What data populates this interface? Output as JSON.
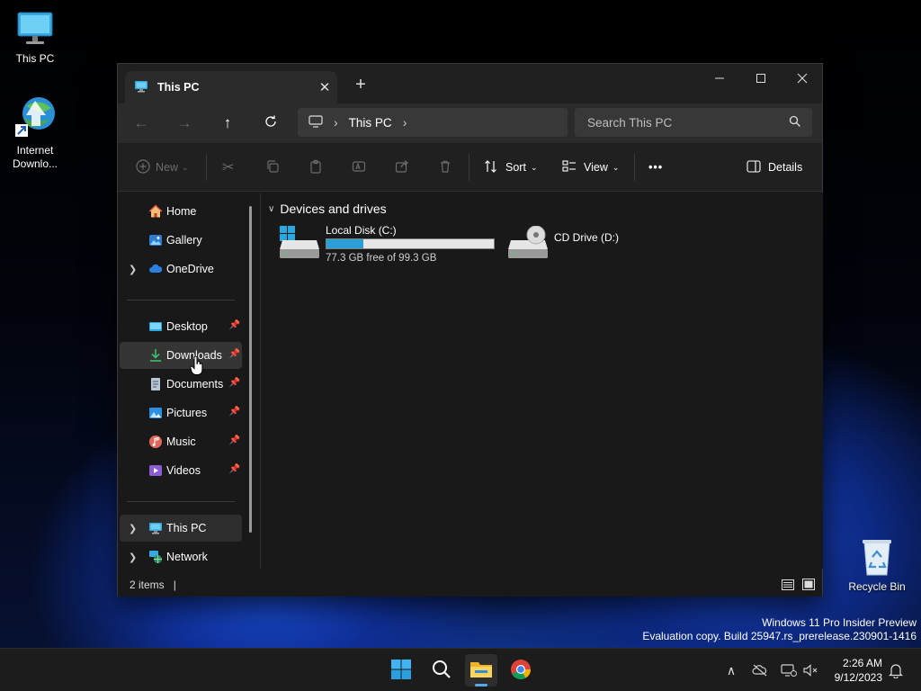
{
  "desktop": {
    "icons": [
      {
        "label": "This PC"
      },
      {
        "label": "Internet Downlo..."
      },
      {
        "label": "Recycle Bin"
      }
    ]
  },
  "window": {
    "tab_title": "This PC",
    "address": {
      "crumbs": [
        "This PC"
      ]
    },
    "search_placeholder": "Search This PC",
    "toolbar": {
      "new_label": "New",
      "sort_label": "Sort",
      "view_label": "View",
      "more_label": "•••",
      "details_label": "Details"
    },
    "sidebar": {
      "items": [
        {
          "label": "Home"
        },
        {
          "label": "Gallery"
        },
        {
          "label": "OneDrive"
        },
        {
          "label": "Desktop"
        },
        {
          "label": "Downloads"
        },
        {
          "label": "Documents"
        },
        {
          "label": "Pictures"
        },
        {
          "label": "Music"
        },
        {
          "label": "Videos"
        },
        {
          "label": "This PC"
        },
        {
          "label": "Network"
        }
      ]
    },
    "content": {
      "group_header": "Devices and drives",
      "drives": [
        {
          "name": "Local Disk (C:)",
          "free_text": "77.3 GB free of 99.3 GB",
          "used_fraction": 0.22
        },
        {
          "name": "CD Drive (D:)"
        }
      ]
    },
    "status": {
      "items_text": "2 items",
      "cursor": "|"
    }
  },
  "watermark": {
    "line1": "Windows 11 Pro Insider Preview",
    "line2": "Evaluation copy. Build 25947.rs_prerelease.230901-1416"
  },
  "taskbar": {
    "time": "2:26 AM",
    "date": "9/12/2023"
  },
  "colors": {
    "accent": "#2a9fd6",
    "window_bg": "#191919",
    "navbar_bg": "#2b2b2b",
    "taskbar_bg": "#1c1c1c"
  }
}
